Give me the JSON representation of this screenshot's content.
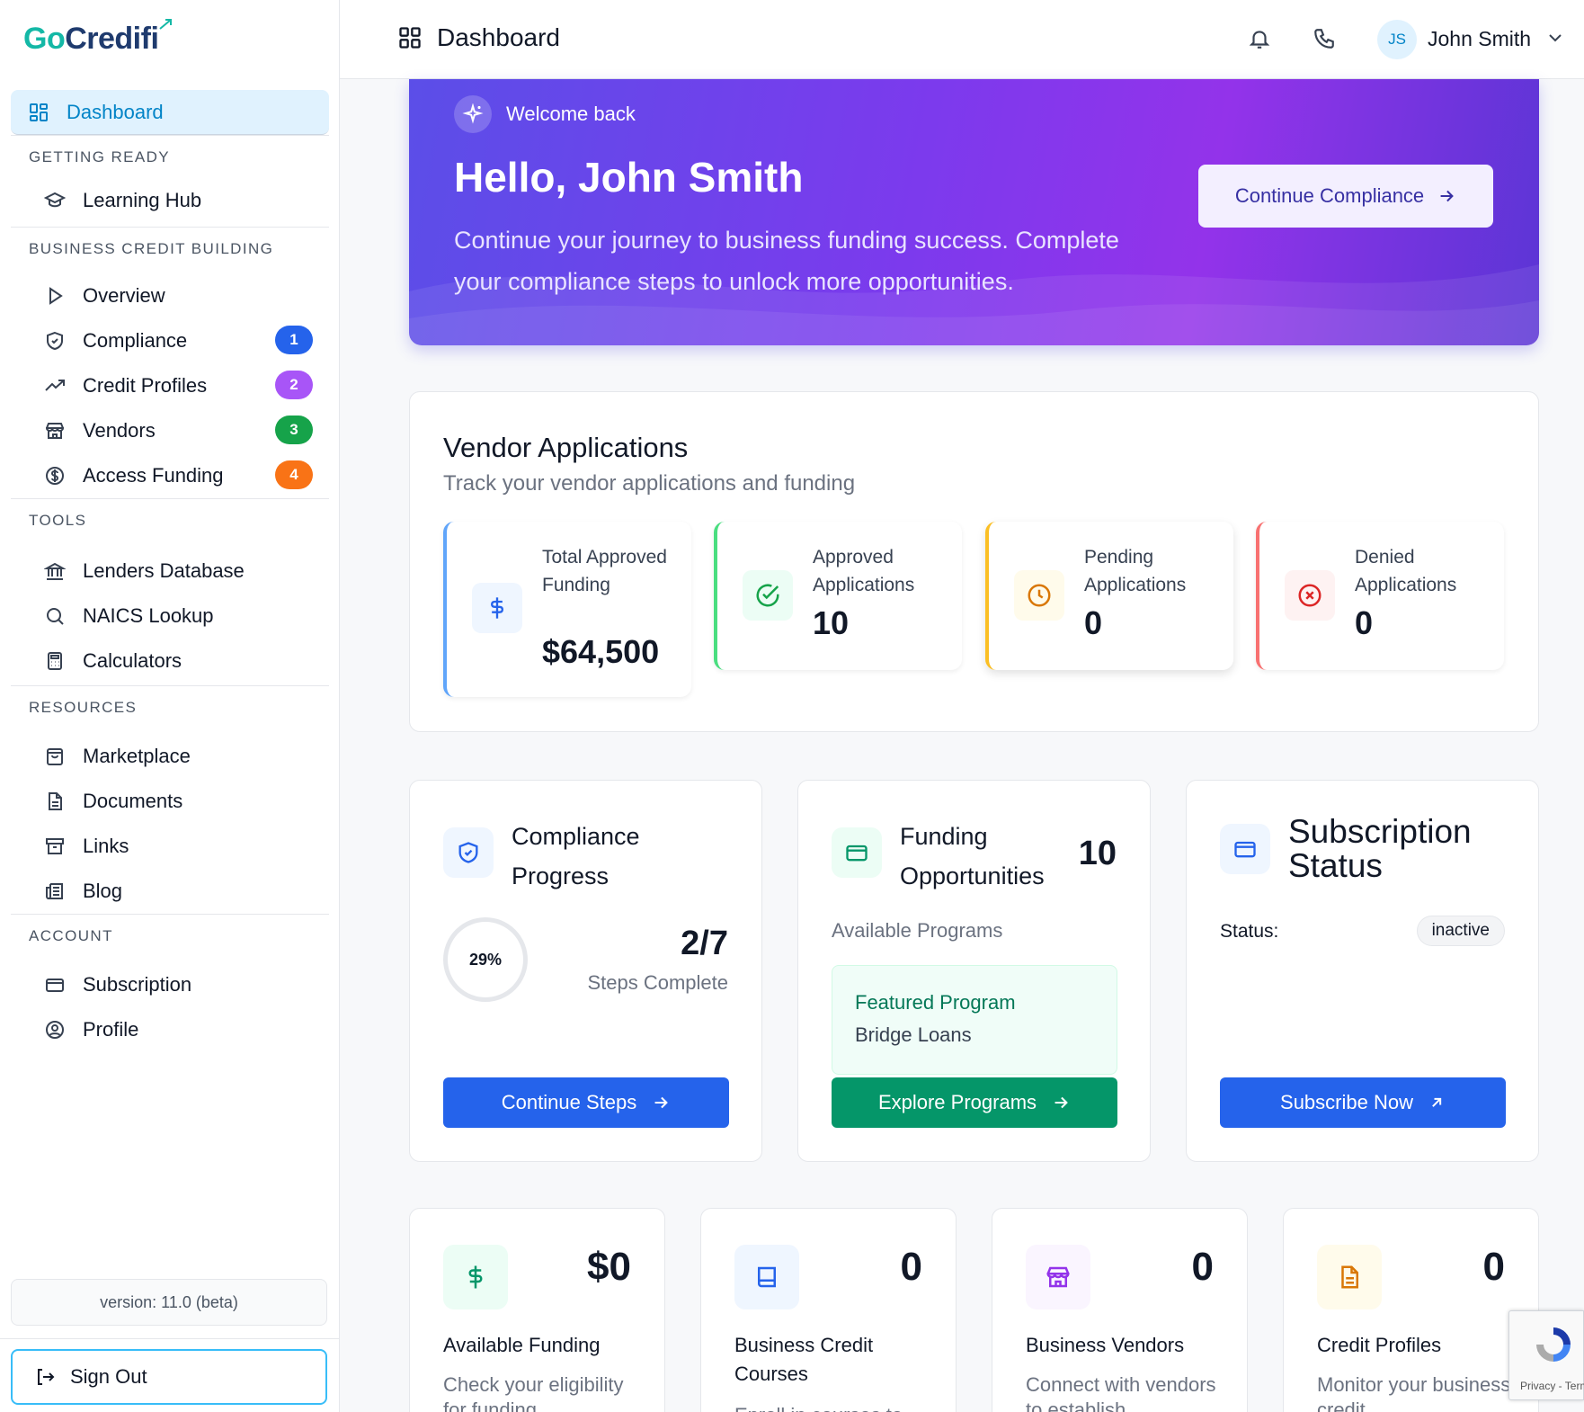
{
  "brand": {
    "logo_go": "Go",
    "logo_rest": "Credifi"
  },
  "sidebar": {
    "dashboard": "Dashboard",
    "sections": {
      "getting_ready": "GETTING READY",
      "business_credit": "BUSINESS CREDIT BUILDING",
      "tools": "TOOLS",
      "resources": "RESOURCES",
      "account": "ACCOUNT"
    },
    "items": {
      "learning_hub": "Learning Hub",
      "overview": "Overview",
      "compliance": "Compliance",
      "credit_profiles": "Credit Profiles",
      "vendors": "Vendors",
      "access_funding": "Access Funding",
      "lenders_database": "Lenders Database",
      "naics_lookup": "NAICS Lookup",
      "calculators": "Calculators",
      "marketplace": "Marketplace",
      "documents": "Documents",
      "links": "Links",
      "blog": "Blog",
      "subscription": "Subscription",
      "profile": "Profile"
    },
    "badges": {
      "compliance": "1",
      "credit_profiles": "2",
      "vendors": "3",
      "access_funding": "4"
    },
    "version": "version: 11.0 (beta)",
    "sign_out": "Sign Out"
  },
  "header": {
    "title": "Dashboard",
    "avatar_initials": "JS",
    "user_name": "John Smith"
  },
  "hero": {
    "welcome": "Welcome back",
    "greeting": "Hello, John Smith",
    "message": "Continue your journey to business funding success. Complete your compliance steps to unlock more opportunities.",
    "cta": "Continue Compliance"
  },
  "vendor_applications": {
    "title": "Vendor Applications",
    "subtitle": "Track your vendor applications and funding",
    "stats": [
      {
        "label": "Total Approved Funding",
        "value": "$64,500"
      },
      {
        "label": "Approved Applications",
        "value": "10"
      },
      {
        "label": "Pending Applications",
        "value": "0"
      },
      {
        "label": "Denied Applications",
        "value": "0"
      }
    ]
  },
  "compliance_card": {
    "title": "Compliance Progress",
    "percent": "29%",
    "steps": "2/7",
    "steps_label": "Steps Complete",
    "button": "Continue Steps"
  },
  "funding_card": {
    "title": "Funding Opportunities",
    "count": "10",
    "available": "Available Programs",
    "featured_label": "Featured Program",
    "featured_name": "Bridge Loans",
    "button": "Explore Programs"
  },
  "subscription_card": {
    "title": "Subscription Status",
    "status_label": "Status:",
    "status_value": "inactive",
    "button": "Subscribe Now"
  },
  "mini_cards": [
    {
      "value": "$0",
      "title": "Available Funding",
      "desc": "Check your eligibility for funding"
    },
    {
      "value": "0",
      "title": "Business Credit Courses",
      "desc": "Enroll in courses to"
    },
    {
      "value": "0",
      "title": "Business Vendors",
      "desc": "Connect with vendors to establish"
    },
    {
      "value": "0",
      "title": "Credit Profiles",
      "desc": "Monitor your business credit"
    }
  ],
  "recaptcha": {
    "text": "Privacy - Terms"
  },
  "colors": {
    "primary": "#2563eb",
    "success": "#059669",
    "accent": "#0284c7",
    "purple": "#7c3aed"
  }
}
